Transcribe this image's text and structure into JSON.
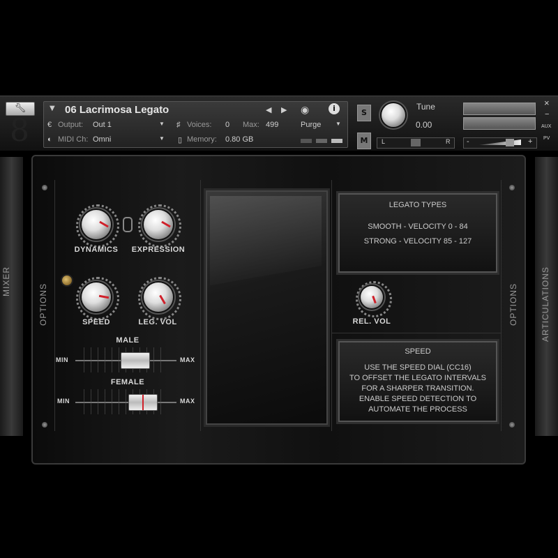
{
  "header": {
    "instrument_name": "06 Lacrimosa Legato",
    "output_label": "Output:",
    "output_value": "Out 1",
    "voices_label": "Voices:",
    "voices_value": "0",
    "max_label": "Max:",
    "max_value": "499",
    "purge_label": "Purge",
    "midi_label": "MIDI Ch:",
    "midi_value": "Omni",
    "memory_label": "Memory:",
    "memory_value": "0.80 GB",
    "solo_label": "S",
    "mute_label": "M",
    "tune_label": "Tune",
    "tune_value": "0.00",
    "pan_left": "L",
    "pan_right": "R",
    "vol_minus": "-",
    "vol_plus": "+",
    "aux_label": "AUX",
    "pv_label": "PV",
    "close_label": "×",
    "minimize_label": "−"
  },
  "side": {
    "mixer_label": "MIXER",
    "articulations_label": "ARTICULATIONS",
    "options_left": "OPTIONS",
    "options_right": "OPTIONS"
  },
  "controls": {
    "dynamics": "DYNAMICS",
    "expression": "EXPRESSION",
    "speed": "SPEED",
    "leg_vol": "LEG. VOL",
    "rel_vol": "REL. VOL",
    "male": "MALE",
    "female": "FEMALE",
    "min": "MIN",
    "max": "MAX",
    "male_level": 0.5,
    "female_level": 0.58
  },
  "legato_screen": {
    "title": "LEGATO TYPES",
    "line1": "SMOOTH - VELOCITY 0 - 84",
    "line2": "STRONG - VELOCITY 85 - 127"
  },
  "speed_screen": {
    "title": "SPEED",
    "line1": "USE THE SPEED DIAL (CC16)",
    "line2": "TO OFFSET THE LEGATO INTERVALS",
    "line3": "FOR A SHARPER TRANSITION.",
    "line4": "ENABLE SPEED DETECTION TO",
    "line5": "AUTOMATE THE PROCESS"
  },
  "colors": {
    "accent_red": "#d0202a",
    "led_amber": "#b08a40"
  }
}
